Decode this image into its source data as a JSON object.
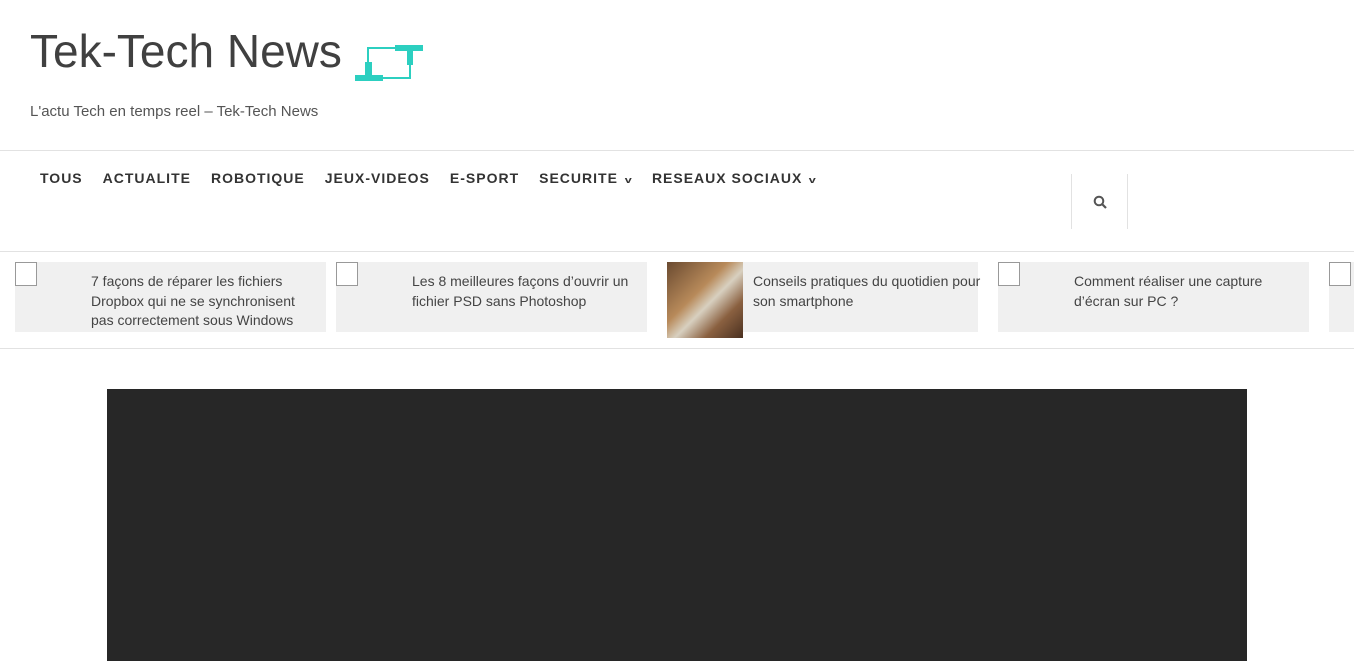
{
  "site": {
    "title": "Tek-Tech News",
    "tagline": "L'actu Tech en temps reel – Tek-Tech News",
    "accent": "#2ccfc0"
  },
  "nav": {
    "items": [
      {
        "label": "TOUS"
      },
      {
        "label": "ACTUALITE"
      },
      {
        "label": "ROBOTIQUE"
      },
      {
        "label": "JEUX-VIDEOS"
      },
      {
        "label": "E-SPORT"
      },
      {
        "label": "SECURITE",
        "dropdown": true
      },
      {
        "label": "RESEAUX SOCIAUX",
        "dropdown": true
      }
    ],
    "search_icon": "search-icon"
  },
  "ticker": [
    {
      "title": "7 façons de réparer les fichiers Dropbox qui ne se synchronisent pas correctement sous Windows"
    },
    {
      "title": "Les 8 meilleures façons d’ouvrir un fichier PSD sans Photoshop"
    },
    {
      "title": "Conseils pratiques du quotidien pour son smartphone"
    },
    {
      "title": "Comment réaliser une capture d’écran sur PC ?"
    }
  ]
}
